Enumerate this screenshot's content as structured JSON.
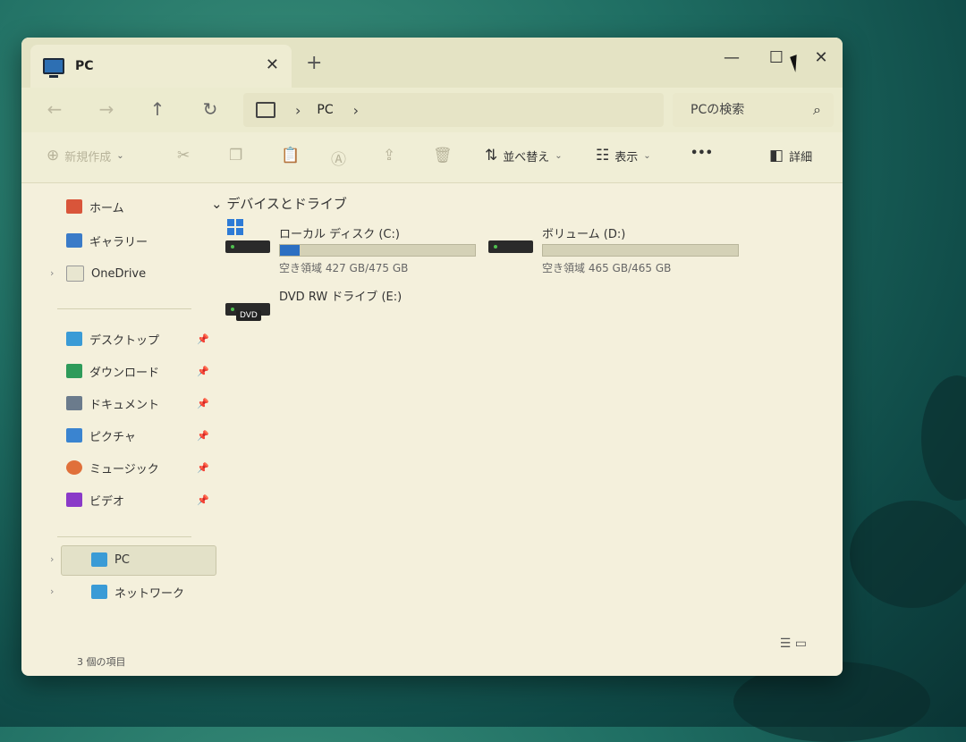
{
  "window": {
    "tab_title": "PC",
    "tab_close": "✕",
    "new_tab": "+",
    "minimize": "—",
    "maximize": "☐",
    "close": "✕"
  },
  "nav": {
    "back": "←",
    "forward": "→",
    "up": "↑",
    "refresh": "↻",
    "breadcrumb": [
      "PC"
    ],
    "search_placeholder": "PCの検索"
  },
  "toolbar": {
    "new_label": "新規作成",
    "sort_label": "並べ替え",
    "view_label": "表示",
    "more_label": "•••",
    "details_label": "詳細"
  },
  "sidebar": {
    "top_items": [
      {
        "label": "ホーム",
        "icon": "home-icon",
        "color": "#d9553a"
      },
      {
        "label": "ギャラリー",
        "icon": "gallery-icon",
        "color": "#3a7bc8"
      },
      {
        "label": "OneDrive",
        "icon": "onedrive-icon",
        "color": "#bbbbbb"
      }
    ],
    "pinned_items": [
      {
        "label": "デスクトップ",
        "icon": "desktop-icon",
        "color": "#3a9bd6"
      },
      {
        "label": "ダウンロード",
        "icon": "download-icon",
        "color": "#2e9b5a"
      },
      {
        "label": "ドキュメント",
        "icon": "documents-icon",
        "color": "#6b7b8c"
      },
      {
        "label": "ピクチャ",
        "icon": "pictures-icon",
        "color": "#3a84d0"
      },
      {
        "label": "ミュージック",
        "icon": "music-icon",
        "color": "#e0703a"
      },
      {
        "label": "ビデオ",
        "icon": "videos-icon",
        "color": "#8a3ac8"
      }
    ],
    "bottom_items": [
      {
        "label": "PC",
        "icon": "pc-icon",
        "color": "#3a9bd6"
      },
      {
        "label": "ネットワーク",
        "icon": "network-icon",
        "color": "#3a9bd6"
      }
    ]
  },
  "status": {
    "item_count": "3 個の項目"
  },
  "content": {
    "group_title": "デバイスとドライブ",
    "drives": [
      {
        "name": "ローカル ディスク (C:)",
        "free_text": "空き領域 427 GB/475 GB",
        "used_fraction": 0.1,
        "icon": "windows-drive-icon"
      },
      {
        "name": "ボリューム (D:)",
        "free_text": "空き領域 465 GB/465 GB",
        "used_fraction": 0.0,
        "icon": "drive-icon"
      },
      {
        "name": "DVD RW ドライブ (E:)",
        "icon": "dvd-drive-icon",
        "badge": "DVD"
      }
    ]
  }
}
